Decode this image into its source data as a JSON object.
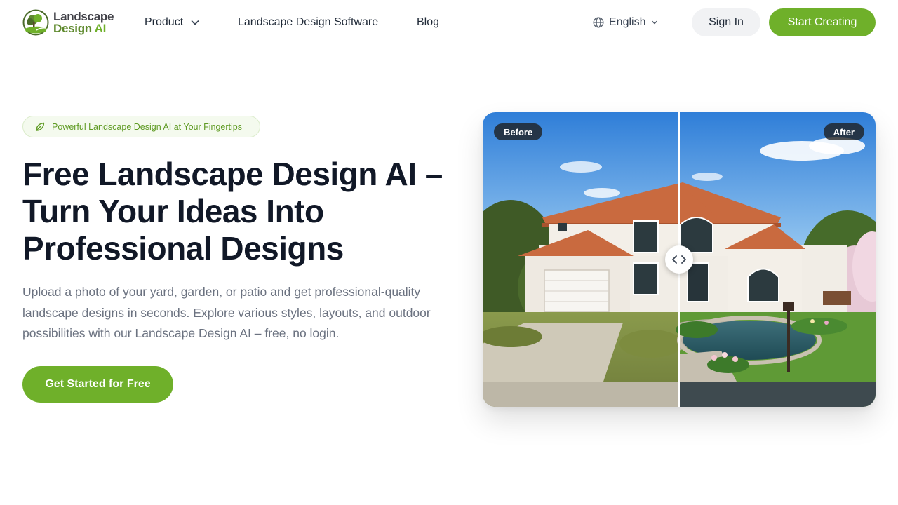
{
  "header": {
    "logo": {
      "line1": "Landscape",
      "line2_prefix": "Design ",
      "line2_ai": "AI"
    },
    "nav": {
      "product": "Product",
      "software": "Landscape Design Software",
      "blog": "Blog"
    },
    "language": "English",
    "sign_in": "Sign In",
    "start_creating": "Start Creating"
  },
  "hero": {
    "badge": "Powerful Landscape Design AI at Your Fingertips",
    "title": "Free Landscape Design AI – Turn Your Ideas Into Professional Designs",
    "description": "Upload a photo of your yard, garden, or patio and get professional-quality landscape designs in seconds. Explore various styles, layouts, and outdoor possibilities with our Landscape Design AI – free, no login.",
    "cta": "Get Started for Free"
  },
  "compare": {
    "before_label": "Before",
    "after_label": "After"
  },
  "icons": {
    "nav_chevron": "chevron-down-icon",
    "language": "globe-icon",
    "badge": "leaf-icon",
    "slider": "left-right-arrows-icon"
  },
  "colors": {
    "brand_green": "#6fb02a",
    "heading": "#111827",
    "body_text": "#6b7280"
  }
}
